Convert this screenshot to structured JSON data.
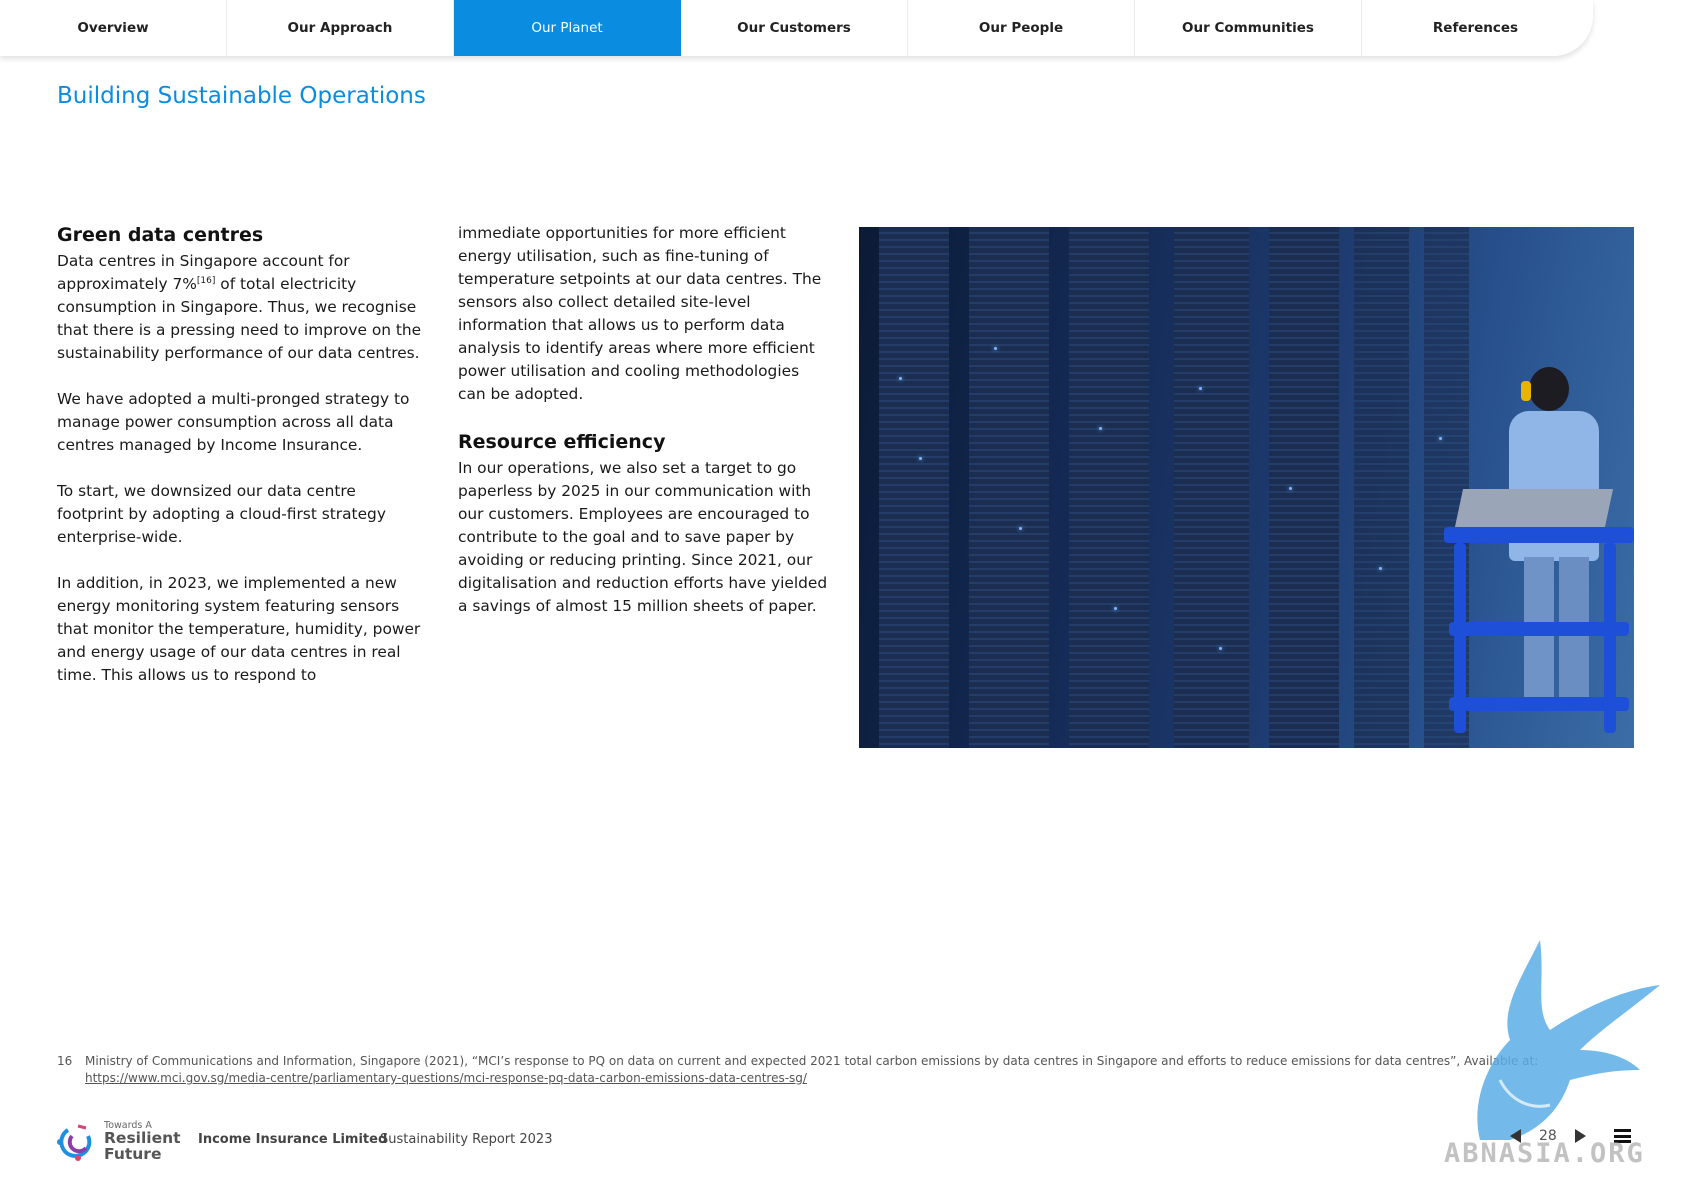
{
  "nav": {
    "tabs": [
      {
        "label": "Overview"
      },
      {
        "label": "Our Approach"
      },
      {
        "label": "Our Planet"
      },
      {
        "label": "Our Customers"
      },
      {
        "label": "Our People"
      },
      {
        "label": "Our Communities"
      },
      {
        "label": "References"
      }
    ],
    "active_index": 2
  },
  "page_title": "Building Sustainable Operations",
  "section1": {
    "heading": "Green data centres",
    "p1_before": "Data centres in Singapore account for approximately 7%",
    "p1_ref": "[16]",
    "p1_after": " of total electricity consumption in Singapore. Thus, we recognise that there is a pressing need to improve on the sustainability performance of our data centres.",
    "p2": "We have adopted a multi-pronged strategy to manage power consumption across all data centres managed by Income Insurance.",
    "p3": "To start, we downsized our data centre footprint by adopting a cloud-first strategy enterprise-wide.",
    "p4": "In addition, in 2023, we implemented a new energy monitoring system featuring sensors that monitor the temperature, humidity, power and energy usage of our data centres in real time. This allows us to respond to",
    "p5": "immediate opportunities for more efficient energy utilisation, such as fine-tuning of temperature setpoints at our data centres. The sensors also collect detailed site-level information that allows us to perform data analysis to identify areas where more efficient power utilisation and cooling methodologies can be adopted."
  },
  "section2": {
    "heading": "Resource efficiency",
    "p1": "In our operations, we also set a target to go paperless by 2025 in our communication with our customers. Employees are encouraged to contribute to the goal and to save paper by avoiding or reducing printing. Since 2021, our digitalisation and reduction efforts have yielded a savings of almost 15 million sheets of paper."
  },
  "footnote": {
    "number": "16",
    "text": "Ministry of Communications and Information, Singapore (2021), “MCI’s response to PQ on data on current and expected 2021 total carbon emissions by data centres in Singapore and efforts to reduce emissions for data centres”, Available at: ",
    "link": "https://www.mci.gov.sg/media-centre/parliamentary-questions/mci-response-pq-data-carbon-emissions-data-centres-sg/"
  },
  "footer": {
    "logo_small": "Towards A",
    "logo_line1": "Resilient",
    "logo_line2": "Future",
    "company": "Income Insurance Limited",
    "report": "Sustainability Report 2023",
    "page_number": "28"
  },
  "watermark": {
    "text": "ABNASIA.ORG"
  },
  "colors": {
    "accent": "#0a8ce0",
    "text": "#1a1a1a"
  },
  "icons": {
    "prev": "triangle-left-icon",
    "next": "triangle-right-icon",
    "menu": "hamburger-menu-icon"
  }
}
